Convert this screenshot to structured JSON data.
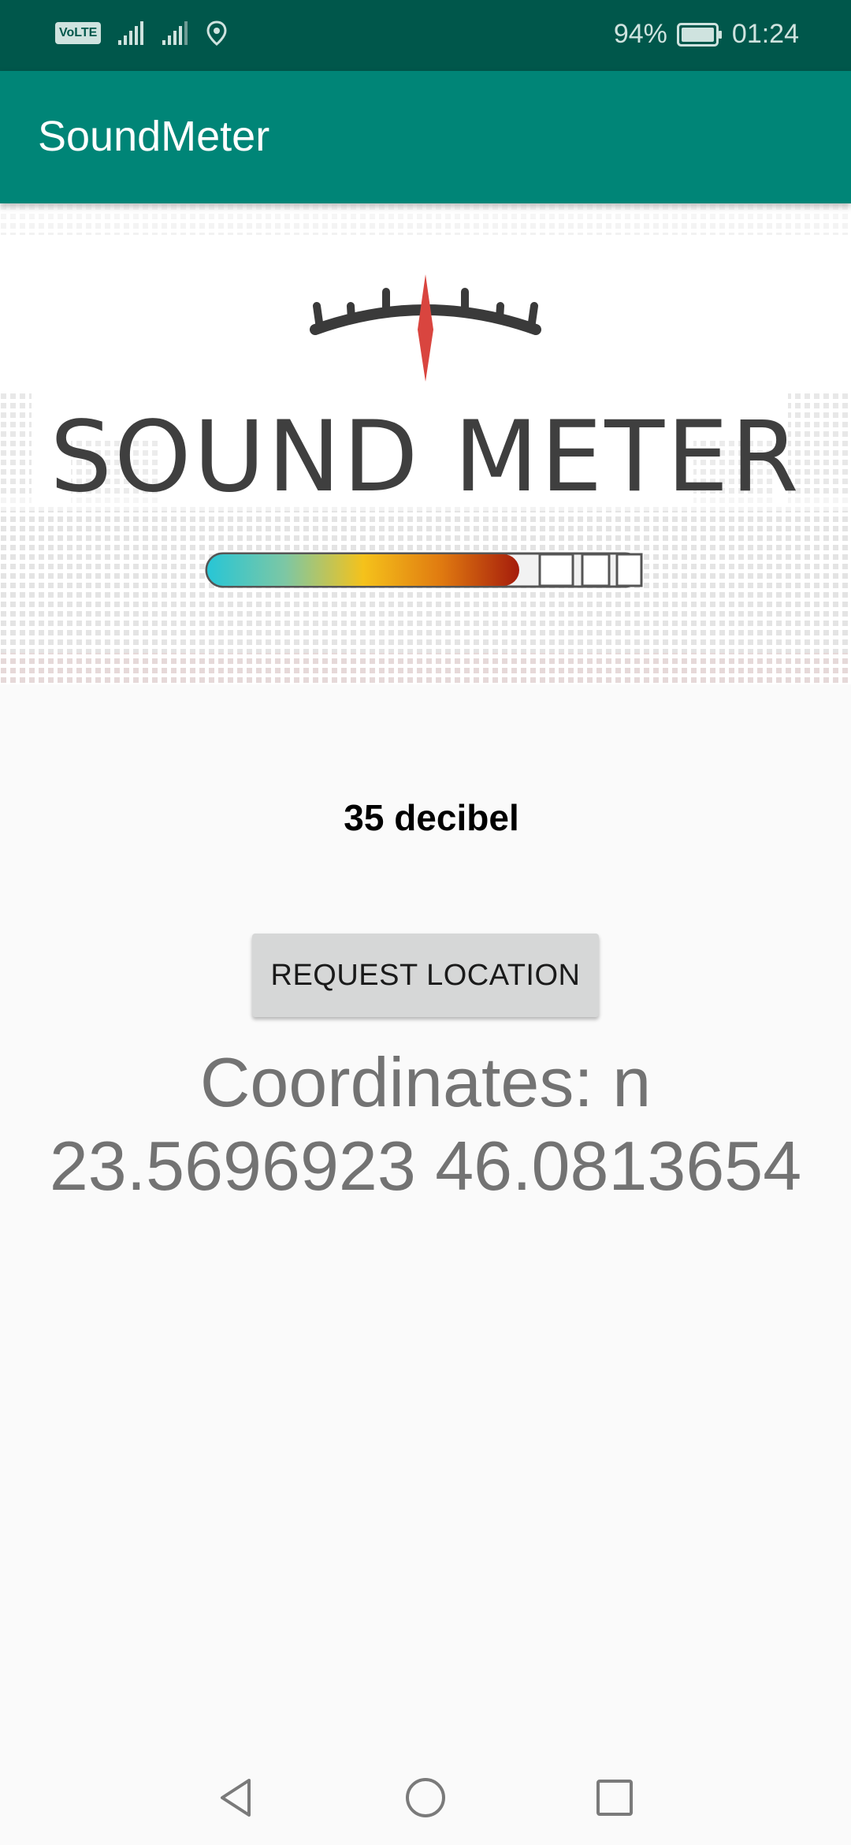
{
  "status_bar": {
    "volte": "VoLTE",
    "battery": "94%",
    "time": "01:24"
  },
  "app_bar": {
    "title": "SoundMeter"
  },
  "header": {
    "logo_text": "SOUND METER",
    "level_fraction": 0.72
  },
  "main": {
    "decibel_text": "35 decibel",
    "request_button_label": "REQUEST LOCATION",
    "coordinates_line1": "Coordinates: n",
    "coordinates_line2": "23.5696923 46.0813654"
  },
  "icons": {
    "status_left": [
      "volte-icon",
      "signal-icon",
      "signal-icon",
      "location-icon"
    ],
    "status_right": [
      "battery-icon"
    ],
    "nav": [
      "back-icon",
      "home-icon",
      "recents-icon"
    ]
  },
  "colors": {
    "status_bar": "#00574b",
    "app_bar": "#008577",
    "background": "#fafafa",
    "needle": "#d9453f",
    "button": "#d6d7d7"
  }
}
